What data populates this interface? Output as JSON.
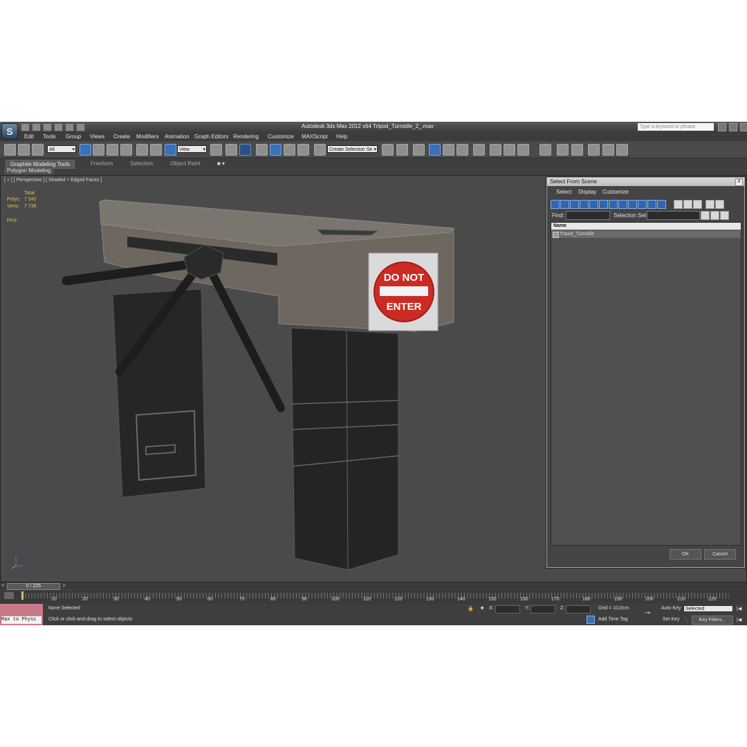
{
  "window": {
    "title": "Autodesk 3ds Max  2012 x64     Tripod_Turnstile_2_.max",
    "search_placeholder": "Type a keyword or phrase"
  },
  "menu": [
    "Edit",
    "Tools",
    "Group",
    "Views",
    "Create",
    "Modifiers",
    "Animation",
    "Graph Editors",
    "Rendering",
    "Customize",
    "MAXScript",
    "Help"
  ],
  "toolbar": {
    "selection_filter": "All",
    "ref_coord": "View",
    "named_selection": "Create Selection Se"
  },
  "ribbon": {
    "tabs": [
      "Graphite Modeling Tools",
      "Freeform",
      "Selection",
      "Object Paint"
    ],
    "sub_panel": "Polygon Modeling"
  },
  "viewport": {
    "label": "[ + ] [ Perspective ] [ Shaded + Edged Faces ]",
    "stats_total_label": "Total",
    "polys_label": "Polys:",
    "polys_value": "7 542",
    "verts_label": "Verts:",
    "verts_value": "7 736",
    "fps_label": "FPS:",
    "sign_line1": "DO NOT",
    "sign_line2": "ENTER"
  },
  "dialog": {
    "title": "Select From Scene",
    "close": "X",
    "menu": [
      "Select",
      "Display",
      "Customize"
    ],
    "find_label": "Find:",
    "selection_set_label": "Selection Set:",
    "column_name": "Name",
    "items": [
      "Tripod_Turnstile"
    ],
    "ok": "OK",
    "cancel": "Cancel"
  },
  "timeline": {
    "slider": "0 / 225",
    "ticks": [
      "10",
      "20",
      "30",
      "40",
      "50",
      "60",
      "70",
      "80",
      "90",
      "100",
      "110",
      "120",
      "130",
      "140",
      "150",
      "160",
      "170",
      "180",
      "190",
      "200",
      "210",
      "220"
    ]
  },
  "status": {
    "script_listener": "Max to Physc",
    "selection": "None Selected",
    "prompt": "Click or click-and-drag to select objects",
    "x_label": "X:",
    "y_label": "Y:",
    "z_label": "Z:",
    "grid": "Grid = 10,0cm",
    "add_time_tag": "Add Time Tag",
    "auto_key": "Auto Key",
    "auto_key_mode": "Selected",
    "set_key": "Set Key",
    "key_filters": "Key Filters..."
  }
}
